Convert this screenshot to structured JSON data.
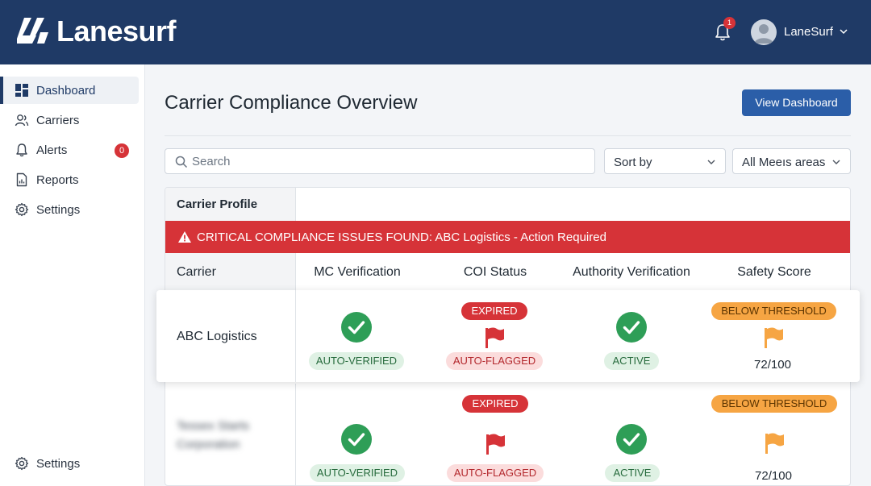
{
  "app": {
    "name": "Lanesurf"
  },
  "header": {
    "user_name": "LaneSurf",
    "notification_count": "1"
  },
  "sidebar": {
    "items": [
      {
        "label": "Dashboard",
        "icon": "dashboard-icon",
        "active": true
      },
      {
        "label": "Carriers",
        "icon": "users-icon"
      },
      {
        "label": "Alerts",
        "icon": "bell-icon",
        "badge": "0"
      },
      {
        "label": "Reports",
        "icon": "report-icon"
      },
      {
        "label": "Settings",
        "icon": "gear-icon"
      }
    ],
    "bottom_item": {
      "label": "Settings",
      "icon": "gear-icon"
    }
  },
  "main": {
    "title": "Carrier Compliance Overview",
    "primary_button": "View Dashboard",
    "search_placeholder": "Search",
    "sort_label": "Sort by",
    "filter_label": "All Meeıs areas"
  },
  "table": {
    "profile_header": "Carrier Profile",
    "alert": "CRITICAL COMPLIANCE ISSUES FOUND: ABC Logistics - Action Required",
    "columns": [
      "Carrier",
      "MC Verification",
      "COI Status",
      "Authority Verification",
      "Safety Score"
    ],
    "rows": [
      {
        "carrier": "ABC Logistics",
        "mc": "AUTO-VERIFIED",
        "coi_top": "EXPIRED",
        "coi": "AUTO-FLAGGED",
        "authority": "ACTIVE",
        "safety_badge": "BELOW THRESHOLD",
        "safety_score": "72/100"
      },
      {
        "carrier": "Tessex Starts Corporation",
        "mc": "AUTO-VERIFIED",
        "coi_top": "EXPIRED",
        "coi": "AUTO-FLAGGED",
        "authority": "ACTIVE",
        "safety_badge": "BELOW THRESHOLD",
        "safety_score": "72/100"
      }
    ]
  },
  "colors": {
    "header_bg": "#1f3a66",
    "primary": "#2b5ea8",
    "alert_red": "#d63338",
    "success_green": "#2e9e57",
    "warning_orange": "#f6a543"
  }
}
